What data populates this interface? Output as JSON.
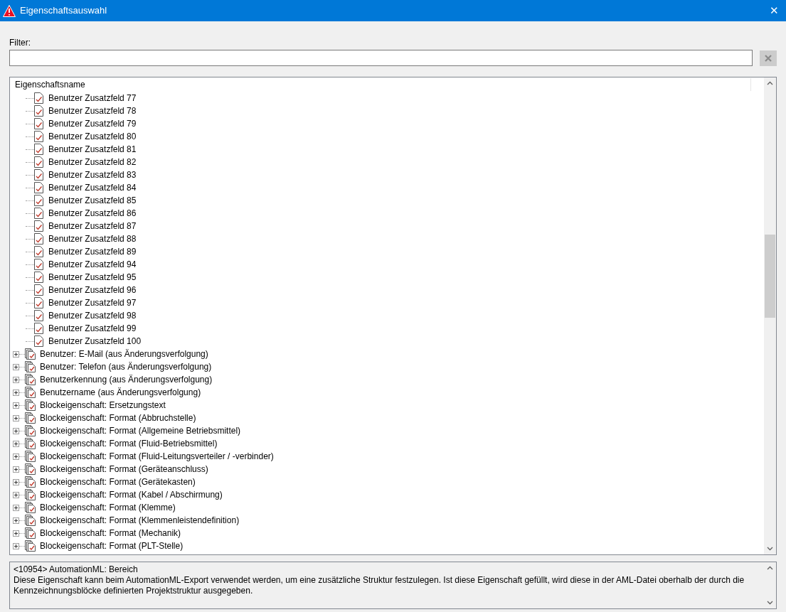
{
  "window": {
    "title": "Eigenschaftsauswahl",
    "close": "✕"
  },
  "filter": {
    "label": "Filter:"
  },
  "tree": {
    "column": "Eigenschaftsname",
    "items": [
      {
        "kind": "leaf",
        "label": "Benutzer Zusatzfeld 77"
      },
      {
        "kind": "leaf",
        "label": "Benutzer Zusatzfeld 78"
      },
      {
        "kind": "leaf",
        "label": "Benutzer Zusatzfeld 79"
      },
      {
        "kind": "leaf",
        "label": "Benutzer Zusatzfeld 80"
      },
      {
        "kind": "leaf",
        "label": "Benutzer Zusatzfeld 81"
      },
      {
        "kind": "leaf",
        "label": "Benutzer Zusatzfeld 82"
      },
      {
        "kind": "leaf",
        "label": "Benutzer Zusatzfeld 83"
      },
      {
        "kind": "leaf",
        "label": "Benutzer Zusatzfeld 84"
      },
      {
        "kind": "leaf",
        "label": "Benutzer Zusatzfeld 85"
      },
      {
        "kind": "leaf",
        "label": "Benutzer Zusatzfeld 86"
      },
      {
        "kind": "leaf",
        "label": "Benutzer Zusatzfeld 87"
      },
      {
        "kind": "leaf",
        "label": "Benutzer Zusatzfeld 88"
      },
      {
        "kind": "leaf",
        "label": "Benutzer Zusatzfeld 89"
      },
      {
        "kind": "leaf",
        "label": "Benutzer Zusatzfeld 94"
      },
      {
        "kind": "leaf",
        "label": "Benutzer Zusatzfeld 95"
      },
      {
        "kind": "leaf",
        "label": "Benutzer Zusatzfeld 96"
      },
      {
        "kind": "leaf",
        "label": "Benutzer Zusatzfeld 97"
      },
      {
        "kind": "leaf",
        "label": "Benutzer Zusatzfeld 98"
      },
      {
        "kind": "leaf",
        "label": "Benutzer Zusatzfeld 99"
      },
      {
        "kind": "leaf",
        "label": "Benutzer Zusatzfeld 100"
      },
      {
        "kind": "group",
        "label": "Benutzer: E-Mail (aus Änderungsverfolgung)",
        "expanded": false
      },
      {
        "kind": "group",
        "label": "Benutzer: Telefon (aus Änderungsverfolgung)",
        "expanded": false
      },
      {
        "kind": "group",
        "label": "Benutzerkennung (aus Änderungsverfolgung)",
        "expanded": false
      },
      {
        "kind": "group",
        "label": "Benutzername (aus Änderungsverfolgung)",
        "expanded": false
      },
      {
        "kind": "group",
        "label": "Blockeigenschaft: Ersetzungstext",
        "expanded": false
      },
      {
        "kind": "group",
        "label": "Blockeigenschaft: Format (Abbruchstelle)",
        "expanded": false
      },
      {
        "kind": "group",
        "label": "Blockeigenschaft: Format (Allgemeine Betriebsmittel)",
        "expanded": false
      },
      {
        "kind": "group",
        "label": "Blockeigenschaft: Format (Fluid-Betriebsmittel)",
        "expanded": false
      },
      {
        "kind": "group",
        "label": "Blockeigenschaft: Format (Fluid-Leitungsverteiler / -verbinder)",
        "expanded": false
      },
      {
        "kind": "group",
        "label": "Blockeigenschaft: Format (Geräteanschluss)",
        "expanded": false
      },
      {
        "kind": "group",
        "label": "Blockeigenschaft: Format (Gerätekasten)",
        "expanded": false
      },
      {
        "kind": "group",
        "label": "Blockeigenschaft: Format (Kabel / Abschirmung)",
        "expanded": false
      },
      {
        "kind": "group",
        "label": "Blockeigenschaft: Format (Klemme)",
        "expanded": false
      },
      {
        "kind": "group",
        "label": "Blockeigenschaft: Format (Klemmenleistendefinition)",
        "expanded": false
      },
      {
        "kind": "group",
        "label": "Blockeigenschaft: Format (Mechanik)",
        "expanded": false
      },
      {
        "kind": "group",
        "label": "Blockeigenschaft: Format (PLT-Stelle)",
        "expanded": false
      }
    ]
  },
  "description": {
    "heading": "<10954> AutomationML: Bereich",
    "text": "Diese Eigenschaft kann beim AutomationML-Export verwendet werden, um eine zusätzliche Struktur festzulegen. Ist diese Eigenschaft gefüllt, wird diese in der AML-Datei oberhalb der durch die Kennzeichnungsblöcke definierten Projektstruktur ausgegeben."
  }
}
